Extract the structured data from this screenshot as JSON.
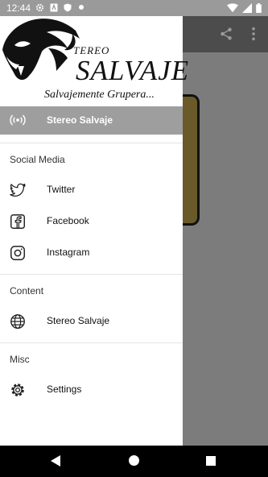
{
  "status_bar": {
    "time": "12:44"
  },
  "header": {
    "brand_top": "TEREO",
    "brand_main": "SALVAJE",
    "brand_sub": "Salvajemente Grupera..."
  },
  "selected_item": {
    "label": "Stereo Salvaje",
    "icon": "radio-broadcast-icon"
  },
  "sections": [
    {
      "title": "Social Media",
      "items": [
        {
          "label": "Twitter",
          "icon": "twitter-icon"
        },
        {
          "label": "Facebook",
          "icon": "facebook-icon"
        },
        {
          "label": "Instagram",
          "icon": "instagram-icon"
        }
      ]
    },
    {
      "title": "Content",
      "items": [
        {
          "label": "Stereo Salvaje",
          "icon": "globe-icon"
        }
      ]
    },
    {
      "title": "Misc",
      "items": [
        {
          "label": "Settings",
          "icon": "gear-icon"
        }
      ]
    }
  ],
  "colors": {
    "status_bar": "#9a9a9a",
    "selected_bg": "#9e9e9e",
    "toolbar_bg": "#4c4c4c",
    "scrim_bg": "#7c7c7c"
  }
}
